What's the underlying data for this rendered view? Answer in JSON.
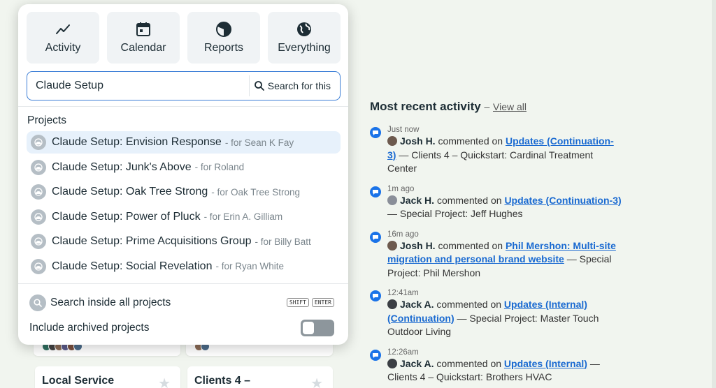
{
  "nav_tiles": [
    {
      "label": "Activity",
      "icon": "activity-icon"
    },
    {
      "label": "Calendar",
      "icon": "calendar-icon"
    },
    {
      "label": "Reports",
      "icon": "reports-icon"
    },
    {
      "label": "Everything",
      "icon": "globe-icon"
    }
  ],
  "search": {
    "value": "Claude Setup",
    "button_label": "Search for this"
  },
  "projects": {
    "heading": "Projects",
    "items": [
      {
        "name": "Claude Setup: Envision Response",
        "for": "- for Sean K Fay"
      },
      {
        "name": "Claude Setup: Junk's Above",
        "for": "- for Roland"
      },
      {
        "name": "Claude Setup: Oak Tree Strong",
        "for": "- for Oak Tree Strong"
      },
      {
        "name": "Claude Setup: Power of Pluck",
        "for": "- for Erin A. Gilliam"
      },
      {
        "name": "Claude Setup: Prime Acquisitions Group",
        "for": "- for Billy Batt"
      },
      {
        "name": "Claude Setup: Social Revelation",
        "for": "- for Ryan White"
      }
    ]
  },
  "footer": {
    "search_inside": "Search inside all projects",
    "kbd_shift": "SHIFT",
    "kbd_enter": "ENTER",
    "include_archived": "Include archived projects"
  },
  "background_cards": {
    "card1_title": "Local Service",
    "card2_title": "Clients 4 –"
  },
  "activity": {
    "title": "Most recent activity",
    "separator": "–",
    "view_all": "View all",
    "items": [
      {
        "time": "Just now",
        "who": "Josh H.",
        "verb": "commented on",
        "link": "Updates (Continuation-3)",
        "rest": "— Clients 4 – Quickstart: Cardinal Treatment Center"
      },
      {
        "time": "1m ago",
        "who": "Jack H.",
        "verb": "commented on",
        "link": "Updates (Continuation-3)",
        "rest": "— Special Project: Jeff Hughes"
      },
      {
        "time": "16m ago",
        "who": "Josh H.",
        "verb": "commented on",
        "link": "Phil Mershon: Multi-site migration and personal brand website",
        "rest": "— Special Project: Phil Mershon"
      },
      {
        "time": "12:41am",
        "who": "Jack A.",
        "verb": "commented on",
        "link": "Updates (Internal) (Continuation)",
        "rest": "— Special Project: Master Touch Outdoor Living"
      },
      {
        "time": "12:26am",
        "who": "Jack A.",
        "verb": "commented on",
        "link": "Updates (Internal)",
        "rest": "— Clients 4 – Quickstart: Brothers HVAC"
      }
    ]
  },
  "colors": {
    "accent": "#1a73e8",
    "link": "#1a6ad1",
    "active_row": "#e7f1fb",
    "page_bg": "#f1f5ef"
  }
}
